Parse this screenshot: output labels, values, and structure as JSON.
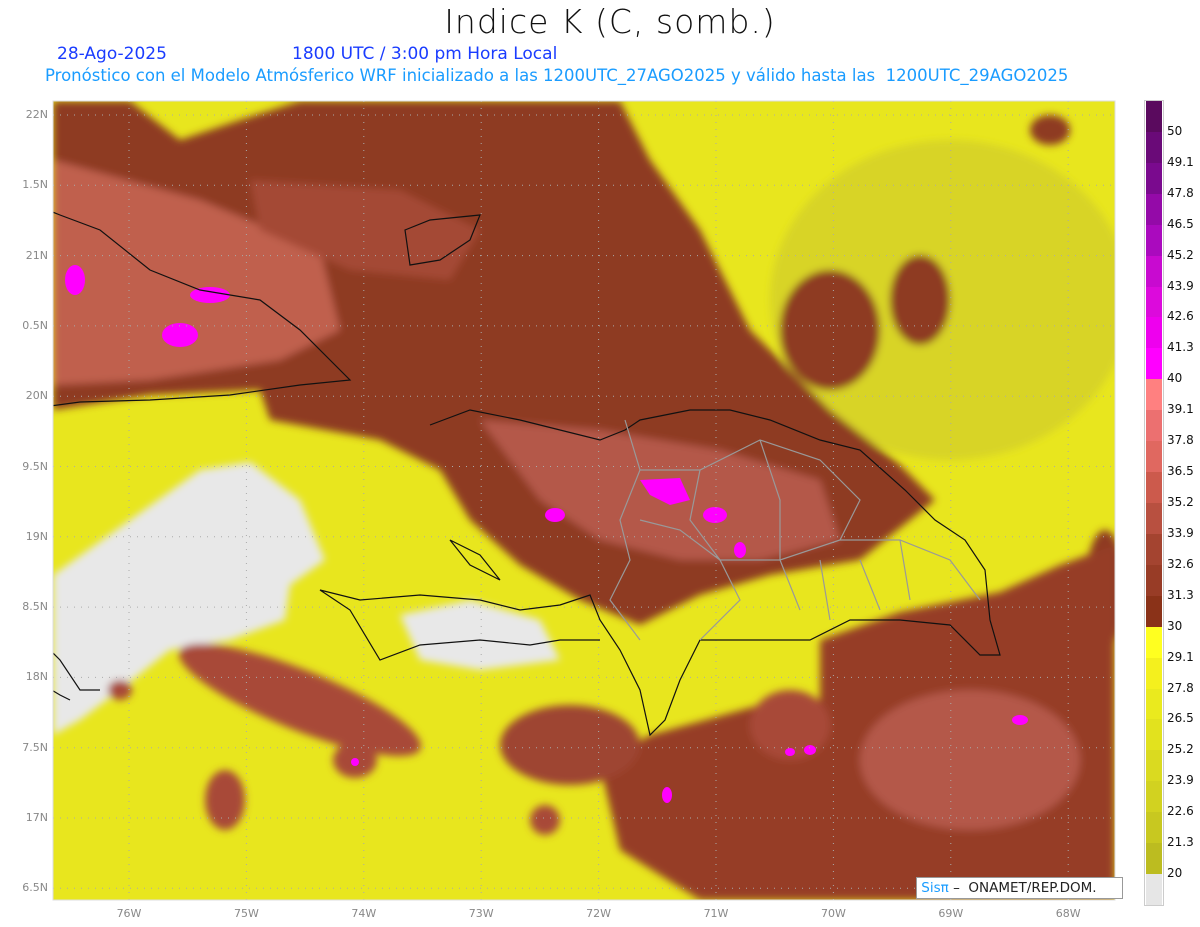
{
  "header": {
    "title": "Indice K (C, somb.)",
    "date": "28-Ago-2025",
    "time": "1800 UTC / 3:00 pm Hora Local",
    "subtitle": "Pronóstico con el Modelo Atmósferico WRF inicializado a las 1200UTC_27AGO2025 y válido hasta las  1200UTC_29AGO2025"
  },
  "axes": {
    "lat_ticks": [
      {
        "label": "22N",
        "value": 22
      },
      {
        "label": "1.5N",
        "value": 21.5
      },
      {
        "label": "21N",
        "value": 21
      },
      {
        "label": "0.5N",
        "value": 20.5
      },
      {
        "label": "20N",
        "value": 20
      },
      {
        "label": "9.5N",
        "value": 19.5
      },
      {
        "label": "19N",
        "value": 19
      },
      {
        "label": "8.5N",
        "value": 18.5
      },
      {
        "label": "18N",
        "value": 18
      },
      {
        "label": "7.5N",
        "value": 17.5
      },
      {
        "label": "17N",
        "value": 17
      },
      {
        "label": "6.5N",
        "value": 16.5
      }
    ],
    "lon_ticks": [
      {
        "label": "76W",
        "value": 76
      },
      {
        "label": "75W",
        "value": 75
      },
      {
        "label": "74W",
        "value": 74
      },
      {
        "label": "73W",
        "value": 73
      },
      {
        "label": "72W",
        "value": 72
      },
      {
        "label": "71W",
        "value": 71
      },
      {
        "label": "70W",
        "value": 70
      },
      {
        "label": "69W",
        "value": 69
      },
      {
        "label": "68W",
        "value": 68
      }
    ]
  },
  "colorbar": {
    "labels": [
      "50",
      "49.1",
      "47.8",
      "46.5",
      "45.2",
      "43.9",
      "42.6",
      "41.3",
      "40",
      "39.1",
      "37.8",
      "36.5",
      "35.2",
      "33.9",
      "32.6",
      "31.3",
      "30",
      "29.1",
      "27.8",
      "26.5",
      "25.2",
      "23.9",
      "22.6",
      "21.3",
      "20"
    ],
    "colors": [
      "#5a0a5e",
      "#6a0a78",
      "#7a0a8e",
      "#940aa8",
      "#aa0abe",
      "#c80ad0",
      "#dc0adc",
      "#ee00ee",
      "#ff00ff",
      "#ff8080",
      "#ec7070",
      "#e06860",
      "#cc5a4c",
      "#b85040",
      "#a44430",
      "#983c26",
      "#8a3218",
      "#ffff20",
      "#f4f01e",
      "#eaea1e",
      "#e2e21e",
      "#dada20",
      "#d2d220",
      "#c8c820",
      "#bcbc20",
      "#e6e6e6"
    ]
  },
  "credit": {
    "brand": "Sisπ",
    "text": " –  ONAMET/REP.DOM."
  }
}
